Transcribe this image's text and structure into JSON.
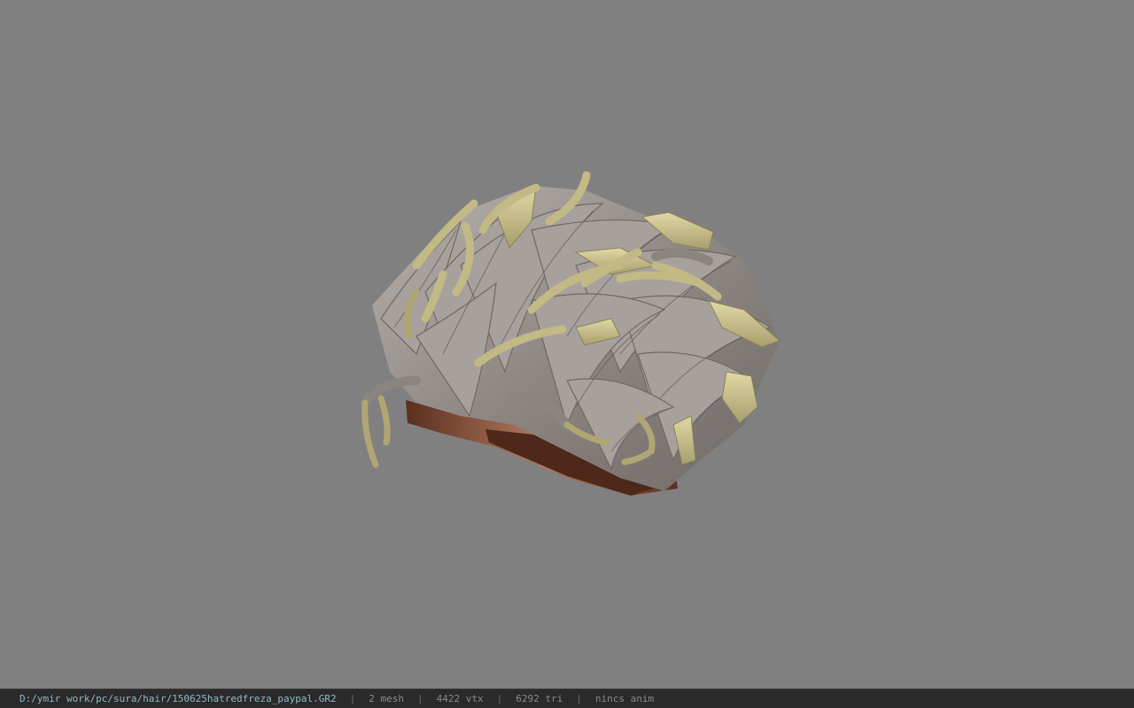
{
  "viewer": {
    "background_color": "#808080",
    "model_icon": "hair-mesh-icon"
  },
  "status": {
    "path": "D:/ymir work/pc/sura/hair/150625hatredfreza_paypal.GR2",
    "mesh": "2 mesh",
    "vtx": "4422 vtx",
    "tri": "6292 tri",
    "anim": "nincs anim",
    "separator": "|"
  },
  "colors": {
    "path_text": "#8fb9c8",
    "status_text": "#8a8a8a",
    "hair_grey": "#9a9590",
    "hair_tip": "#cfc48e",
    "scalp": "#6a3a26"
  }
}
